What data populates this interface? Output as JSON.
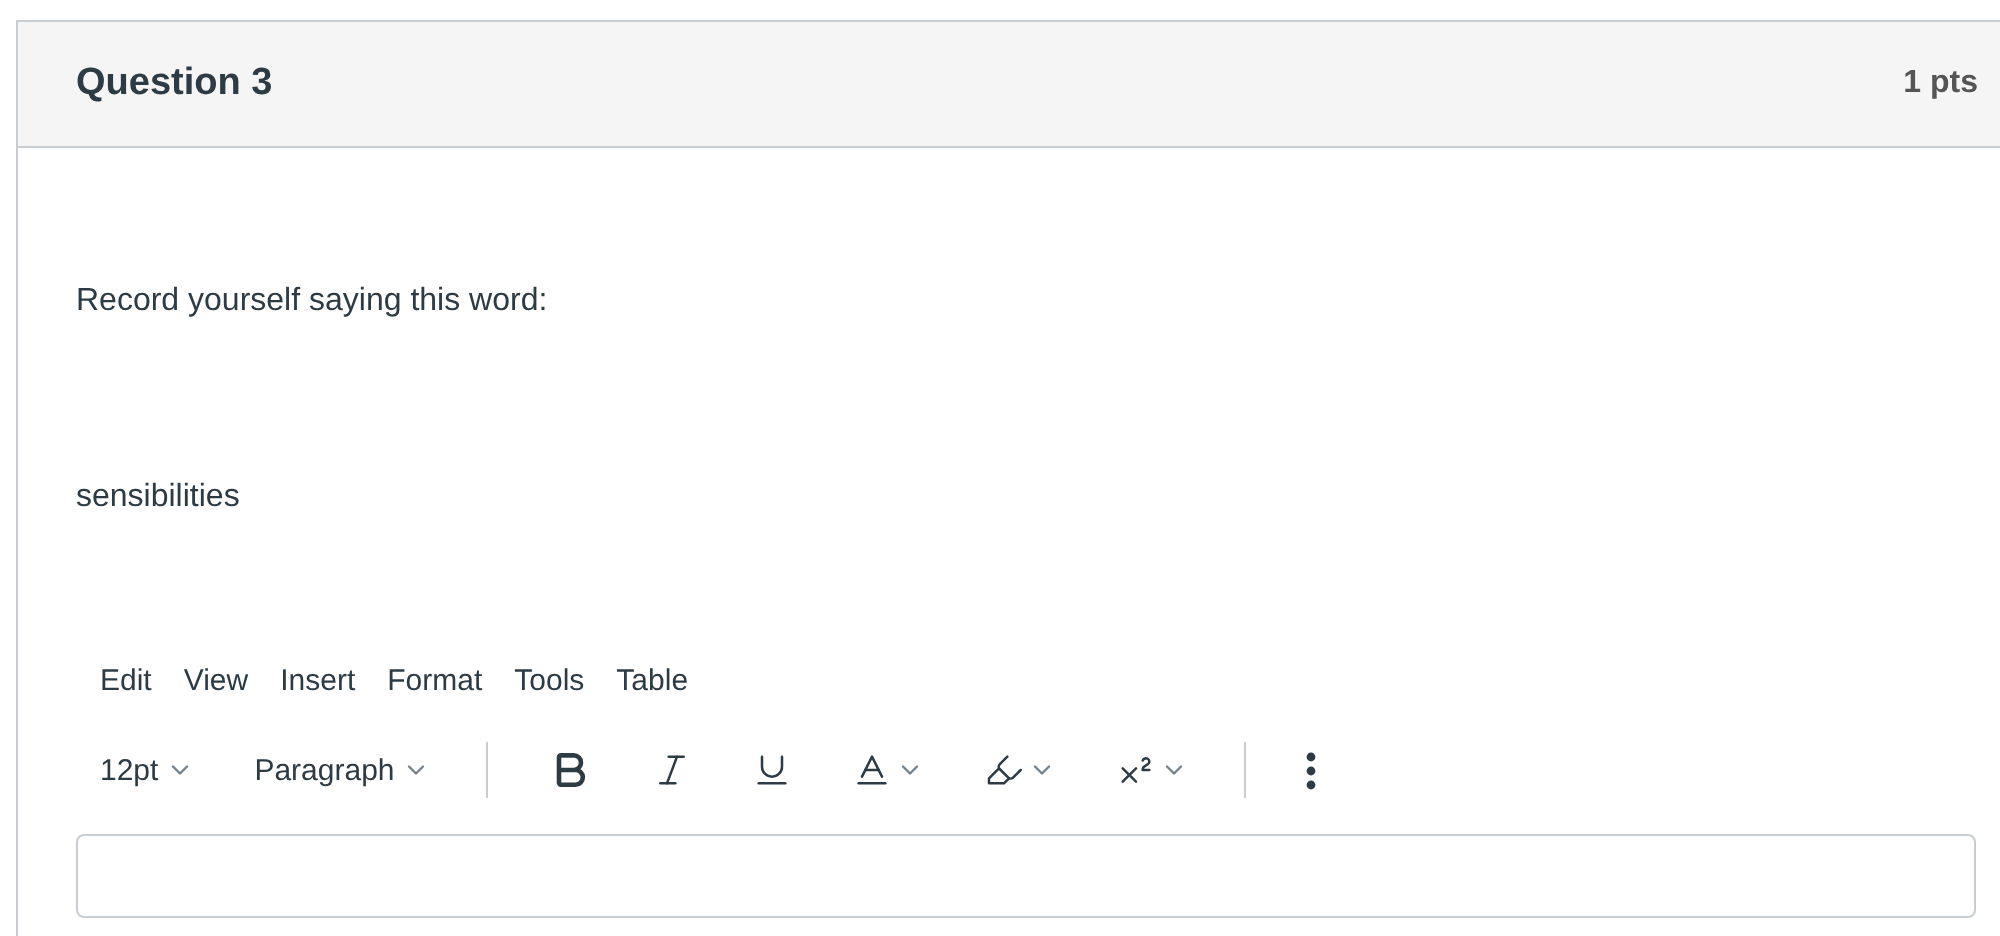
{
  "question": {
    "title": "Question 3",
    "points": "1 pts"
  },
  "paragraphs": [
    "Record yourself saying this word:",
    "sensibilities"
  ],
  "editor": {
    "menu": [
      "Edit",
      "View",
      "Insert",
      "Format",
      "Tools",
      "Table"
    ],
    "font_size": "12pt",
    "block_format": "Paragraph"
  }
}
